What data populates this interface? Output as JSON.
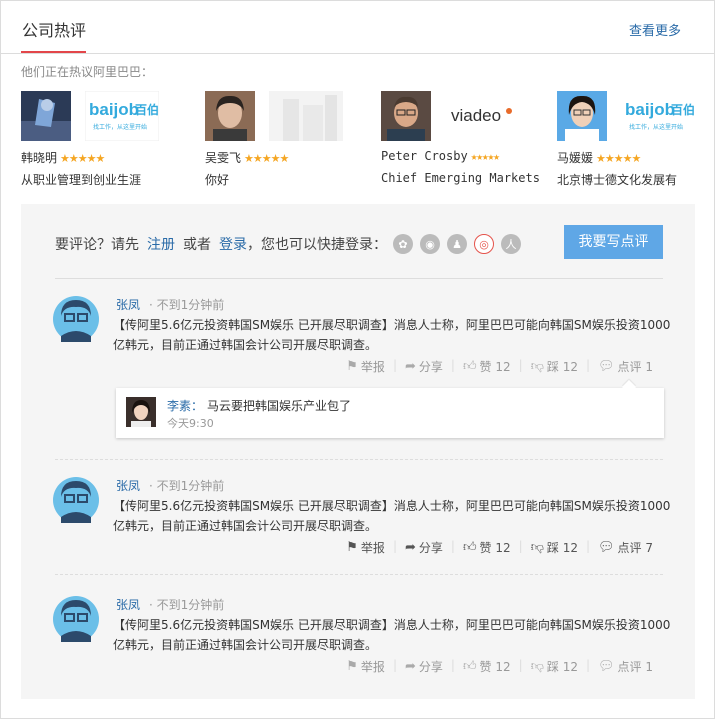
{
  "header": {
    "title": "公司热评",
    "more": "查看更多"
  },
  "discuss_label": "他们正在热议阿里巴巴：",
  "companies": [
    {
      "name": "韩晓明",
      "desc": "从职业管理到创业生涯",
      "stars": "★★★★★",
      "logo": "baidu-bobai"
    },
    {
      "name": "吴雯飞",
      "desc": "你好",
      "stars": "★★★★★",
      "logo": "building"
    },
    {
      "name": "Peter Crosby",
      "desc": "Chief Emerging Markets",
      "stars": "★★★★★",
      "logo": "viadeo"
    },
    {
      "name": "马媛媛",
      "desc": "北京博士德文化发展有",
      "stars": "★★★★★",
      "logo": "baidu-bobai"
    }
  ],
  "logos": {
    "baidu": "baijob",
    "baidu_cn": "百伯",
    "baidu_sub": "找工作，从这里开始",
    "viadeo": "viadeo"
  },
  "login": {
    "prefix": "要评论？请先",
    "register": "注册",
    "or": "或者",
    "login": "登录",
    "suffix": "，您也可以快捷登录："
  },
  "write_button": "我要写点评",
  "comments": [
    {
      "user": "张凤",
      "time": "· 不到1分钟前",
      "text": "【传阿里5.6亿元投资韩国SM娱乐 已开展尽职调查】消息人士称，阿里巴巴可能向韩国SM娱乐投资1000亿韩元，目前正通过韩国会计公司开展尽职调查。",
      "report": "举报",
      "share": "分享",
      "like": "赞 12",
      "dislike": "踩 12",
      "reply": "点评 1",
      "replies": [
        {
          "user": "李素：",
          "text": "马云要把韩国娱乐产业包了",
          "time": "今天9:30"
        }
      ]
    },
    {
      "user": "张凤",
      "time": "· 不到1分钟前",
      "text": "【传阿里5.6亿元投资韩国SM娱乐 已开展尽职调查】消息人士称，阿里巴巴可能向韩国SM娱乐投资1000亿韩元，目前正通过韩国会计公司开展尽职调查。",
      "report": "举报",
      "share": "分享",
      "like": "赞 12",
      "dislike": "踩 12",
      "reply": "点评 7"
    },
    {
      "user": "张凤",
      "time": "· 不到1分钟前",
      "text": "【传阿里5.6亿元投资韩国SM娱乐 已开展尽职调查】消息人士称，阿里巴巴可能向韩国SM娱乐投资1000亿韩元，目前正通过韩国会计公司开展尽职调查。",
      "report": "举报",
      "share": "分享",
      "like": "赞 12",
      "dislike": "踩 12",
      "reply": "点评 1"
    }
  ],
  "colors": {
    "accent": "#e3464a",
    "link": "#2a6ba8",
    "button": "#5fa7e6",
    "star": "#f5a623"
  }
}
